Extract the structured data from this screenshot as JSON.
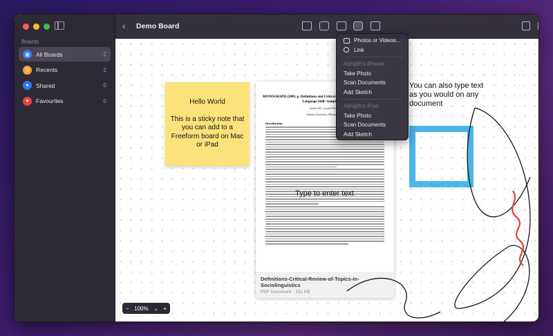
{
  "sidebar": {
    "section_label": "Boards",
    "items": [
      {
        "label": "All Boards",
        "count": "2",
        "icon": "grid-icon",
        "color": "#2f7bf5"
      },
      {
        "label": "Recents",
        "count": "2",
        "icon": "clock-icon",
        "color": "#f2a33a"
      },
      {
        "label": "Shared",
        "count": "0",
        "icon": "people-icon",
        "color": "#2f7bf5"
      },
      {
        "label": "Favourites",
        "count": "0",
        "icon": "heart-icon",
        "color": "#e84141"
      }
    ]
  },
  "toolbar": {
    "back": "‹",
    "title": "Demo Board"
  },
  "canvas": {
    "sticky_title": "Hello World",
    "sticky_body": "This is a sticky note that you can add to a Freeform board on Mac or iPad",
    "text_box": "You can also type text as you would on any document",
    "type_hint": "Type to enter text",
    "doc": {
      "page_title": "MONOGRAPH (2009, p. Definitions and Critical Literature Review of L Choice and Language Skill: Samples of La",
      "author": "Serafin M. Coronel-Molina",
      "affiliation": "Indiana University, Bloomington",
      "section": "Introduction",
      "filename": "Definitions-Critical-Review-of-Topics-in-Sociolinguistics",
      "meta": "PDF Document · 191 KB"
    },
    "zoom": {
      "minus": "−",
      "level": "100%",
      "chevron": "⌄",
      "plus": "+"
    }
  },
  "menu": {
    "photos": "Photos or Videos...",
    "link": "Link",
    "iphone_header": "Abhijith's iPhone",
    "iphone_items": [
      "Take Photo",
      "Scan Documents",
      "Add Sketch"
    ],
    "ipad_header": "Abhijith's iPad",
    "ipad_items": [
      "Take Photo",
      "Scan Documents",
      "Add Sketch"
    ]
  },
  "colors": {
    "sticky": "#fce27a",
    "frame": "#4bb4ea",
    "accent": "#2f7bf5"
  }
}
